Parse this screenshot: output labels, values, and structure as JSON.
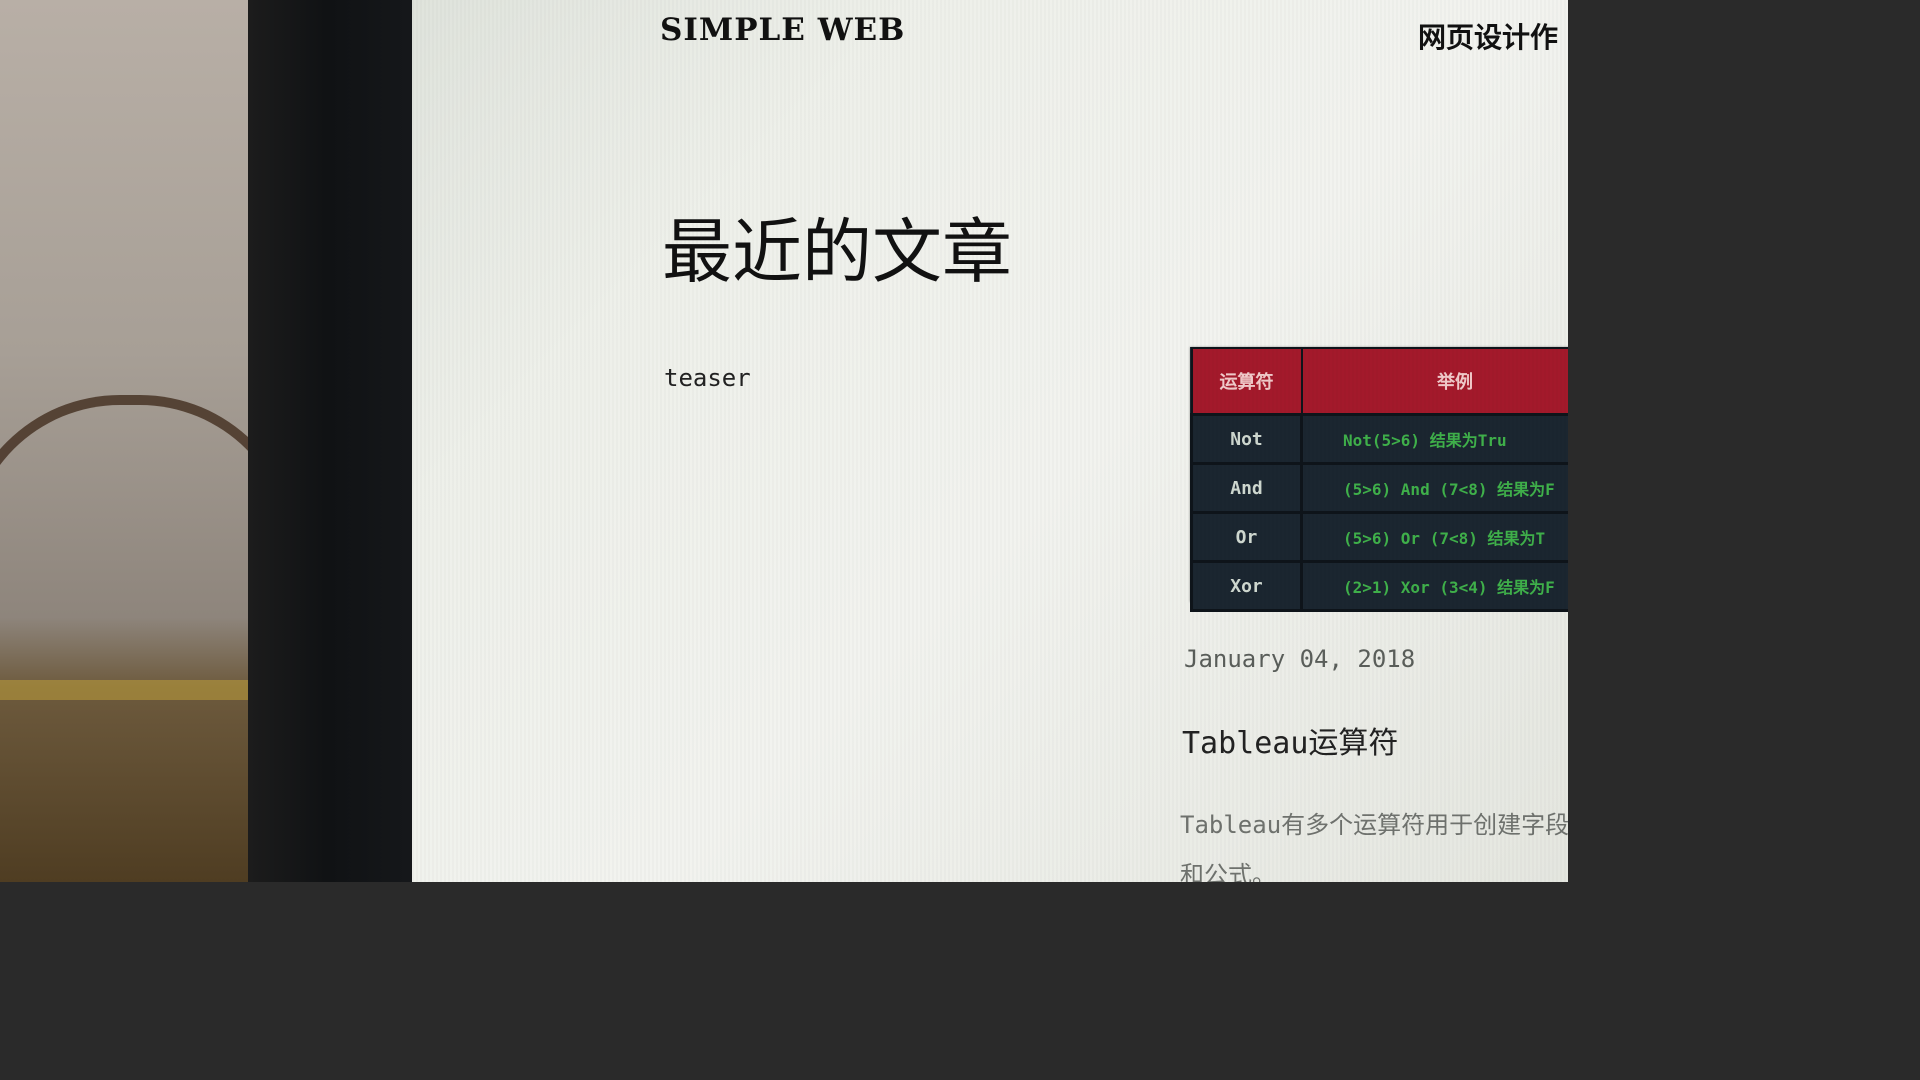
{
  "site": {
    "logo": "SIMPLE WEB",
    "nav_item": "网页设计作"
  },
  "main": {
    "heading": "最近的文章",
    "teaser": "teaser"
  },
  "post": {
    "image_table": {
      "headers": [
        "运算符",
        "举例"
      ],
      "rows": [
        {
          "op": "Not",
          "example": "Not(5>6) 结果为Tru"
        },
        {
          "op": "And",
          "example": "(5>6) And (7<8) 结果为F"
        },
        {
          "op": "Or",
          "example": "(5>6) Or (7<8) 结果为T"
        },
        {
          "op": "Xor",
          "example": "(2>1) Xor (3<4) 结果为F"
        }
      ]
    },
    "date": "January 04, 2018",
    "title": "Tableau运算符",
    "excerpt": "Tableau有多个运算符用于创建字段和公式。"
  },
  "colors": {
    "table_header": "#a3192b",
    "table_body": "#1b2630",
    "example_text": "#3fb04a"
  }
}
